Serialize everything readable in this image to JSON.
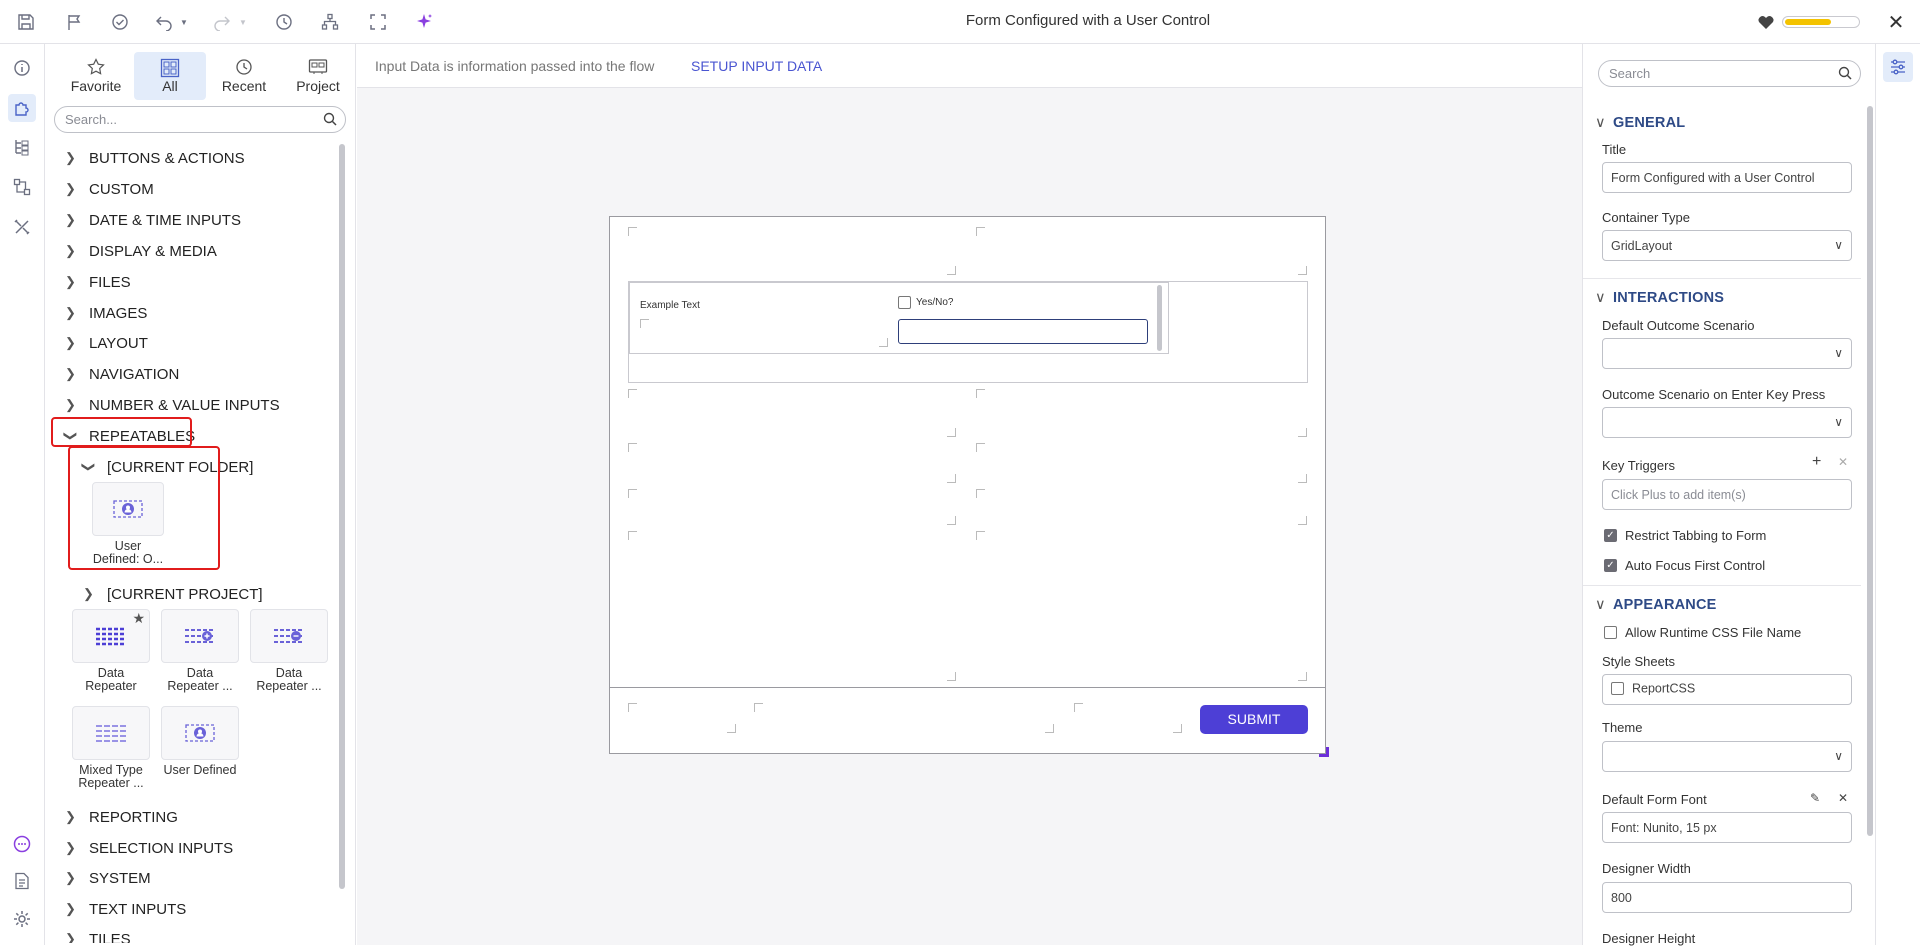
{
  "window": {
    "title": "Form Configured with a User Control",
    "health_fraction": 0.62
  },
  "toolbar": {
    "icons": [
      "save-icon",
      "flag-icon",
      "check-circle-icon",
      "undo-icon",
      "redo-icon",
      "history-icon",
      "hierarchy-icon",
      "fullscreen-icon",
      "ai-sparkle-icon"
    ]
  },
  "toolbox": {
    "tabs": [
      {
        "label": "Favorite",
        "icon": "star-icon"
      },
      {
        "label": "All",
        "icon": "grid-icon"
      },
      {
        "label": "Recent",
        "icon": "clock-icon"
      },
      {
        "label": "Project",
        "icon": "project-icon"
      }
    ],
    "active_tab": "All",
    "search_placeholder": "Search...",
    "categories_top": [
      "BUTTONS & ACTIONS",
      "CUSTOM",
      "DATE & TIME INPUTS",
      "DISPLAY & MEDIA",
      "FILES",
      "IMAGES",
      "LAYOUT",
      "NAVIGATION",
      "NUMBER & VALUE INPUTS",
      "REPEATABLES"
    ],
    "current_folder": "[CURRENT FOLDER]",
    "folder_tile": {
      "line1": "User",
      "line2": "Defined: O..."
    },
    "current_project": "[CURRENT PROJECT]",
    "repeatable_tiles": [
      {
        "line1": "Data",
        "line2": "Repeater"
      },
      {
        "line1": "Data",
        "line2": "Repeater ..."
      },
      {
        "line1": "Data",
        "line2": "Repeater ..."
      },
      {
        "line1": "Mixed Type",
        "line2": "Repeater ..."
      },
      {
        "line1": "User Defined",
        "line2": ""
      }
    ],
    "categories_bottom": [
      "REPORTING",
      "SELECTION INPUTS",
      "SYSTEM",
      "TEXT INPUTS",
      "TILES"
    ]
  },
  "canvas": {
    "input_text": "Input Data is information passed into the flow",
    "input_link": "SETUP INPUT DATA",
    "example_text": "Example Text",
    "checkbox_label": "Yes/No?",
    "submit": "SUBMIT"
  },
  "properties": {
    "search_placeholder": "Search",
    "general": "GENERAL",
    "title_label": "Title",
    "title_value": "Form Configured with a User Control",
    "container_type_label": "Container Type",
    "container_type_value": "GridLayout",
    "interactions": "INTERACTIONS",
    "default_outcome_label": "Default Outcome Scenario",
    "enter_key_label": "Outcome Scenario on Enter Key Press",
    "key_triggers_label": "Key Triggers",
    "key_triggers_placeholder": "Click Plus to add item(s)",
    "restrict_tabbing": "Restrict Tabbing to Form",
    "auto_focus": "Auto Focus First Control",
    "appearance": "APPEARANCE",
    "allow_css": "Allow Runtime CSS File Name",
    "style_sheets_label": "Style Sheets",
    "style_sheet_item": "ReportCSS",
    "theme_label": "Theme",
    "font_label": "Default Form Font",
    "font_value": "Font: Nunito, 15 px",
    "designer_width_label": "Designer Width",
    "designer_width_value": "800",
    "designer_height_label": "Designer Height"
  }
}
